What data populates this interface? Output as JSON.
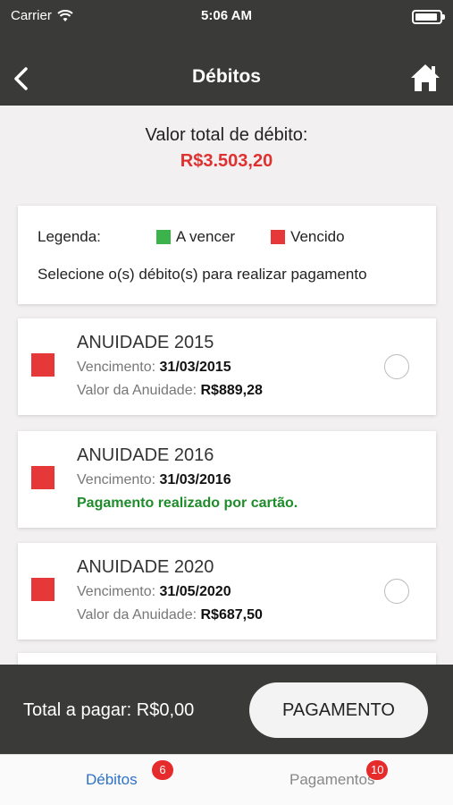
{
  "status_bar": {
    "carrier": "Carrier",
    "time": "5:06 AM"
  },
  "nav": {
    "title": "Débitos"
  },
  "summary": {
    "label": "Valor total de débito:",
    "value": "R$3.503,20"
  },
  "legend": {
    "label": "Legenda:",
    "items": [
      {
        "label": "A vencer",
        "color": "#3cb34a"
      },
      {
        "label": "Vencido",
        "color": "#e63838"
      }
    ],
    "instruction": "Selecione o(s) débito(s) para realizar pagamento"
  },
  "debts": [
    {
      "title": "ANUIDADE 2015",
      "due_label": "Vencimento:",
      "due_date": "31/03/2015",
      "amount_label": "Valor da Anuidade:",
      "amount": "R$889,28",
      "status_color": "#e63838"
    },
    {
      "title": "ANUIDADE 2016",
      "due_label": "Vencimento:",
      "due_date": "31/03/2016",
      "paid_message": "Pagamento realizado por cartão.",
      "status_color": "#e63838"
    },
    {
      "title": "ANUIDADE 2020",
      "due_label": "Vencimento:",
      "due_date": "31/05/2020",
      "amount_label": "Valor da Anuidade:",
      "amount": "R$687,50",
      "status_color": "#e63838"
    }
  ],
  "footer": {
    "total_label": "Total a pagar:",
    "total_value": "R$0,00",
    "pay_button": "PAGAMENTO"
  },
  "tabs": [
    {
      "label": "Débitos",
      "badge": "6"
    },
    {
      "label": "Pagamentos",
      "badge": "10"
    }
  ]
}
